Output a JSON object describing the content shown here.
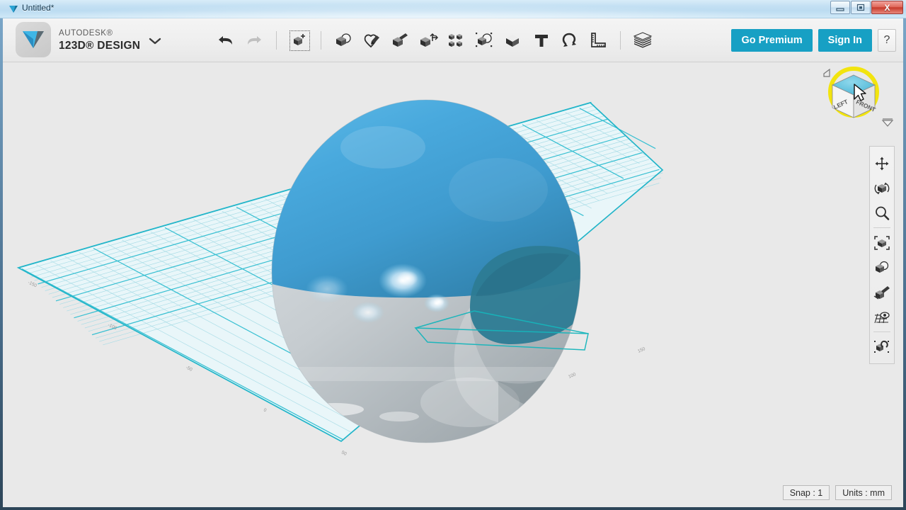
{
  "window": {
    "title": "Untitled*",
    "title_icon": "autodesk-logo-icon",
    "buttons": {
      "minimize": "minimize-icon",
      "maximize": "maximize-icon",
      "close": "X"
    }
  },
  "header": {
    "brand": {
      "logo": "autodesk-123d-logo-icon",
      "line1": "AUTODESK®",
      "line2": "123D® DESIGN",
      "menu_caret": "chevron-down-icon"
    },
    "tools": [
      {
        "id": "undo",
        "icon": "undo-arrow-icon",
        "label": "Undo",
        "state": "enabled",
        "selected": false
      },
      {
        "id": "redo",
        "icon": "redo-arrow-icon",
        "label": "Redo",
        "state": "disabled",
        "selected": false
      },
      {
        "id": "separator-1",
        "icon": "separator",
        "label": "",
        "state": "static",
        "selected": false
      },
      {
        "id": "transform",
        "icon": "transform-cube-plus-icon",
        "label": "Transform",
        "state": "enabled",
        "selected": true
      },
      {
        "id": "separator-2",
        "icon": "separator",
        "label": "",
        "state": "static",
        "selected": false
      },
      {
        "id": "primitives",
        "icon": "primitives-cube-sphere-icon",
        "label": "Primitives",
        "state": "enabled",
        "selected": false
      },
      {
        "id": "sketch",
        "icon": "sketch-pencil-icon",
        "label": "Sketch",
        "state": "enabled",
        "selected": false
      },
      {
        "id": "construct",
        "icon": "construct-extrude-icon",
        "label": "Construct",
        "state": "enabled",
        "selected": false
      },
      {
        "id": "modify",
        "icon": "modify-cube-arrows-icon",
        "label": "Modify",
        "state": "enabled",
        "selected": false
      },
      {
        "id": "pattern",
        "icon": "pattern-four-cubes-icon",
        "label": "Pattern",
        "state": "enabled",
        "selected": false
      },
      {
        "id": "grouping",
        "icon": "grouping-cube-circle-icon",
        "label": "Grouping",
        "state": "enabled",
        "selected": false
      },
      {
        "id": "combine",
        "icon": "combine-cube-icon",
        "label": "Combine",
        "state": "enabled",
        "selected": false
      },
      {
        "id": "text",
        "icon": "text-t-icon",
        "label": "Text",
        "state": "enabled",
        "selected": false
      },
      {
        "id": "snap",
        "icon": "snap-magnet-icon",
        "label": "Snap",
        "state": "enabled",
        "selected": false
      },
      {
        "id": "measure",
        "icon": "measure-ruler-icon",
        "label": "Measure",
        "state": "enabled",
        "selected": false
      },
      {
        "id": "separator-3",
        "icon": "separator",
        "label": "",
        "state": "static",
        "selected": false
      },
      {
        "id": "materials",
        "icon": "materials-stack-icon",
        "label": "Materials",
        "state": "enabled",
        "selected": false
      }
    ],
    "go_premium_label": "Go Premium",
    "sign_in_label": "Sign In",
    "help_label": "?",
    "accent_color": "#17a0c4"
  },
  "viewport": {
    "background_color": "#e9e9e9",
    "grid": {
      "line_color": "#35c3d4",
      "minor_line_color": "#9ed9e4",
      "fill_color": "#e3f4f8"
    },
    "model": {
      "name": "sphere-model",
      "top_color": "#4aa8d8",
      "bottom_color": "#c9cfd2",
      "cut_color": "#2e7d95",
      "sketch_outline_color": "#17b3b8"
    },
    "view_cube": {
      "name": "view-cube",
      "face_front": "FRONT",
      "face_left": "LEFT",
      "highlight_color": "#f2e40f",
      "dropdown_icon": "chevron-down-icon",
      "cursor": "mouse-pointer-icon"
    }
  },
  "nav_tools": [
    {
      "id": "pan",
      "icon": "pan-move-icon",
      "label": "Pan"
    },
    {
      "id": "orbit",
      "icon": "orbit-rotate-cube-icon",
      "label": "Orbit"
    },
    {
      "id": "zoom",
      "icon": "zoom-magnifier-icon",
      "label": "Zoom"
    },
    {
      "id": "separator-a",
      "icon": "separator",
      "label": ""
    },
    {
      "id": "fit",
      "icon": "fit-to-view-icon",
      "label": "Fit"
    },
    {
      "id": "hide-show",
      "icon": "hide-show-cube-icon",
      "label": "Hide/Show"
    },
    {
      "id": "section-view",
      "icon": "section-view-icon",
      "label": "Section View"
    },
    {
      "id": "grid-display",
      "icon": "grid-eye-icon",
      "label": "Grid Display"
    },
    {
      "id": "separator-b",
      "icon": "separator",
      "label": ""
    },
    {
      "id": "snap-settings",
      "icon": "snap-cube-magnet-icon",
      "label": "Snap Settings"
    }
  ],
  "status": {
    "snap": "Snap : 1",
    "units": "Units : mm"
  }
}
